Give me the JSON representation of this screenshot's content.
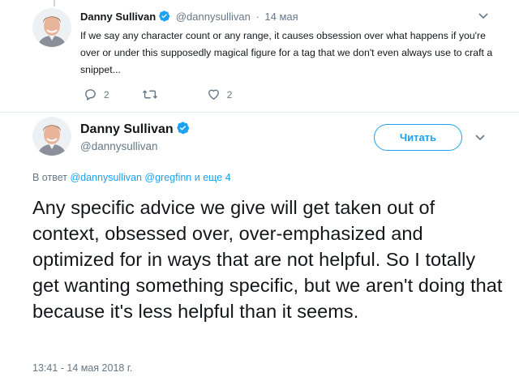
{
  "parent_tweet": {
    "name": "Danny Sullivan",
    "handle": "@dannysullivan",
    "separator": "·",
    "date": "14 мая",
    "text": "If we say any character count or any range, it causes obsession over what happens if you're over or under this supposedly magical figure for a tag that we don't even always use to craft a snippet...",
    "reply_count": "2",
    "like_count": "2",
    "verified": true
  },
  "main_tweet": {
    "name": "Danny Sullivan",
    "handle": "@dannysullivan",
    "verified": true,
    "follow_label": "Читать",
    "reply_prefix": "В ответ",
    "reply_mentions": [
      "@dannysullivan",
      "@gregfinn"
    ],
    "reply_suffix": "и еще 4",
    "text": "Any specific advice we give will get taken out of context, obsessed over, over-emphasized and optimized for in ways that are not helpful. So I totally get wanting something specific, but we aren't doing that because it's less helpful than it seems.",
    "timestamp": "13:41 - 14 мая 2018 г."
  },
  "icons": {
    "verified": "verified-badge-icon",
    "reply": "reply-icon",
    "retweet": "retweet-icon",
    "like": "heart-icon",
    "menu": "chevron-down-icon"
  },
  "colors": {
    "brand": "#1da1f2",
    "text": "#14171a",
    "muted": "#657786",
    "divider": "#e6ecf0"
  }
}
